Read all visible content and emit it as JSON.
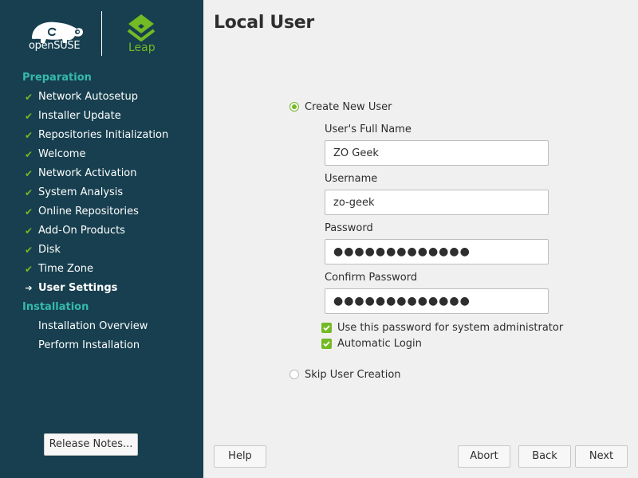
{
  "branding": {
    "opensuse_text": "openSUSE",
    "leap_text": "Leap",
    "leap_color": "#73ba25",
    "sidebar_color": "#173f4f",
    "section_color": "#35b9ab"
  },
  "sidebar": {
    "preparation_title": "Preparation",
    "installation_title": "Installation",
    "steps": [
      {
        "label": "Network Autosetup",
        "state": "done"
      },
      {
        "label": "Installer Update",
        "state": "done"
      },
      {
        "label": "Repositories Initialization",
        "state": "done"
      },
      {
        "label": "Welcome",
        "state": "done"
      },
      {
        "label": "Network Activation",
        "state": "done"
      },
      {
        "label": "System Analysis",
        "state": "done"
      },
      {
        "label": "Online Repositories",
        "state": "done"
      },
      {
        "label": "Add-On Products",
        "state": "done"
      },
      {
        "label": "Disk",
        "state": "done"
      },
      {
        "label": "Time Zone",
        "state": "done"
      },
      {
        "label": "User Settings",
        "state": "current"
      }
    ],
    "install_steps": [
      {
        "label": "Installation Overview"
      },
      {
        "label": "Perform Installation"
      }
    ],
    "release_notes_label": "Release Notes..."
  },
  "main": {
    "title": "Local User",
    "create_new_user_label": "Create New User",
    "full_name_label": "User's Full Name",
    "full_name_value": "ZO Geek",
    "username_label": "Username",
    "username_value": "zo-geek",
    "password_label": "Password",
    "password_value": "●●●●●●●●●●●●●",
    "confirm_password_label": "Confirm Password",
    "confirm_password_value": "●●●●●●●●●●●●●",
    "use_for_admin_label": "Use this password for system administrator",
    "automatic_login_label": "Automatic Login",
    "skip_user_creation_label": "Skip User Creation"
  },
  "buttons": {
    "help": "Help",
    "abort": "Abort",
    "back": "Back",
    "next": "Next"
  }
}
